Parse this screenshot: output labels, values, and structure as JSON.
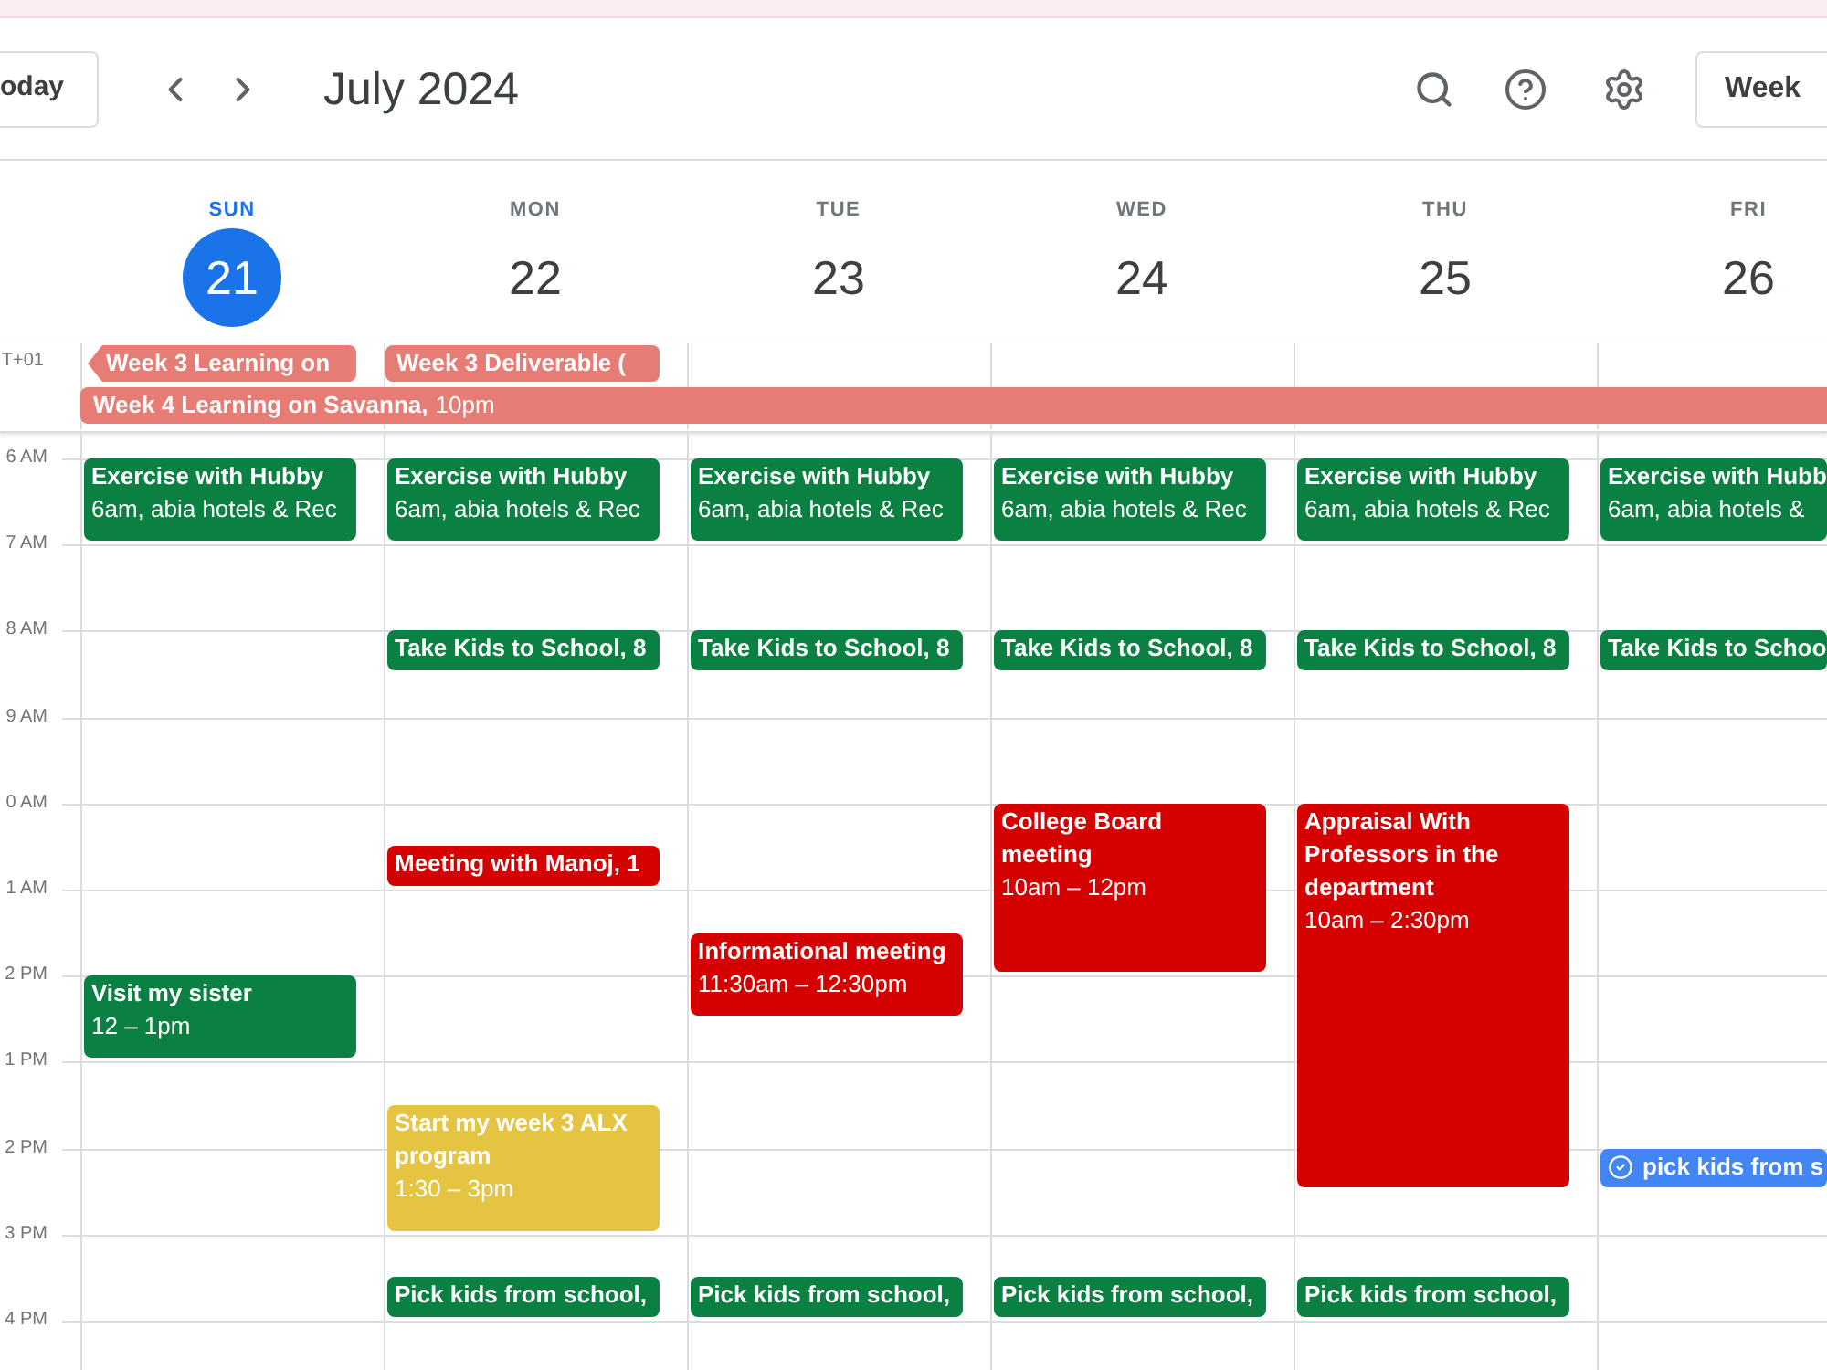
{
  "toolbar": {
    "today_button": "oday",
    "title": "July 2024",
    "view_button": "Week"
  },
  "timezone": "T+01",
  "hours": [
    "6 AM",
    "7 AM",
    "8 AM",
    "9 AM",
    "0 AM",
    "1 AM",
    "2 PM",
    "1 PM",
    "2 PM",
    "3 PM",
    "4 PM"
  ],
  "days": [
    {
      "name": "SUN",
      "date": "21",
      "selected": true,
      "all_day": [
        {
          "title": "Week 3 Learning on",
          "continues_before": true,
          "continues_after": false,
          "color": "#e67c73"
        },
        {
          "title": "Week 4 Learning on Savanna,",
          "time": "10pm",
          "continues_before": false,
          "continues_after": true,
          "color": "#e67c73"
        }
      ],
      "events": [
        {
          "kind": "event",
          "title": "Exercise with Hubby",
          "detail": "6am, abia hotels & Rec",
          "color": "#0b8043"
        },
        {
          "kind": "event",
          "title": "Visit my sister",
          "detail": "12 – 1pm",
          "color": "#0b8043"
        }
      ]
    },
    {
      "name": "MON",
      "date": "22",
      "selected": false,
      "all_day": [
        {
          "title": "Week 3 Deliverable (",
          "continues_before": false,
          "continues_after": false,
          "color": "#e67c73"
        }
      ],
      "events": [
        {
          "kind": "event",
          "title": "Exercise with Hubby",
          "detail": "6am, abia hotels & Rec",
          "color": "#0b8043"
        },
        {
          "kind": "event",
          "title": "Take Kids to School, 8",
          "color": "#0b8043"
        },
        {
          "kind": "event",
          "title": "Meeting with Manoj, 1",
          "color": "#d50000"
        },
        {
          "kind": "event",
          "title": "Start my week 3 ALX program",
          "detail": "1:30 – 3pm",
          "color": "#e4c441"
        },
        {
          "kind": "event",
          "title": "Pick kids from school,",
          "color": "#0b8043"
        }
      ]
    },
    {
      "name": "TUE",
      "date": "23",
      "selected": false,
      "events": [
        {
          "kind": "event",
          "title": "Exercise with Hubby",
          "detail": "6am, abia hotels & Rec",
          "color": "#0b8043"
        },
        {
          "kind": "event",
          "title": "Take Kids to School, 8",
          "color": "#0b8043"
        },
        {
          "kind": "event",
          "title": "Informational meeting",
          "detail": "11:30am – 12:30pm",
          "color": "#d50000"
        },
        {
          "kind": "event",
          "title": "Pick kids from school,",
          "color": "#0b8043"
        }
      ]
    },
    {
      "name": "WED",
      "date": "24",
      "selected": false,
      "events": [
        {
          "kind": "event",
          "title": "Exercise with Hubby",
          "detail": "6am, abia hotels & Rec",
          "color": "#0b8043"
        },
        {
          "kind": "event",
          "title": "Take Kids to School, 8",
          "color": "#0b8043"
        },
        {
          "kind": "event",
          "title": "College Board meeting",
          "detail": "10am – 12pm",
          "color": "#d50000"
        },
        {
          "kind": "event",
          "title": "Pick kids from school,",
          "color": "#0b8043"
        }
      ]
    },
    {
      "name": "THU",
      "date": "25",
      "selected": false,
      "events": [
        {
          "kind": "event",
          "title": "Exercise with Hubby",
          "detail": "6am, abia hotels & Rec",
          "color": "#0b8043"
        },
        {
          "kind": "event",
          "title": "Take Kids to School, 8",
          "color": "#0b8043"
        },
        {
          "kind": "event",
          "title": "Appraisal With Professors in the department",
          "detail": "10am – 2:30pm",
          "color": "#d50000"
        },
        {
          "kind": "event",
          "title": "Pick kids from school,",
          "color": "#0b8043"
        }
      ]
    },
    {
      "name": "FRI",
      "date": "26",
      "selected": false,
      "events": [
        {
          "kind": "event",
          "title": "Exercise with Hubb",
          "detail": "6am, abia hotels &",
          "color": "#0b8043"
        },
        {
          "kind": "event",
          "title": "Take Kids to Schoo",
          "color": "#0b8043"
        },
        {
          "kind": "task",
          "title": "pick kids from s",
          "color": "#4285f4"
        }
      ]
    }
  ]
}
